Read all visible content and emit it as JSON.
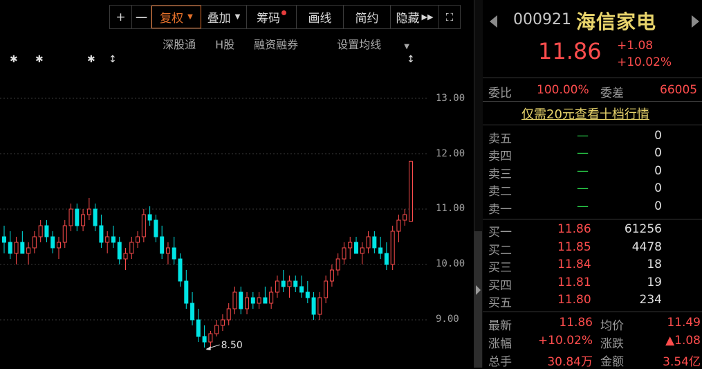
{
  "toolbar": {
    "plus": "+",
    "minus": "一",
    "fuquan": "复权",
    "diejia": "叠加",
    "chouma": "筹码",
    "huaxian": "画线",
    "jianyue": "简约",
    "yincang": "隐藏"
  },
  "subbar": {
    "sgt": "深股通",
    "hgu": "H股",
    "rzrq": "融资融券",
    "sheding": "设置均线"
  },
  "axis": {
    "ticks": [
      "13.00",
      "12.00",
      "11.00",
      "10.00",
      "9.00"
    ],
    "low_label": "8.50"
  },
  "stock": {
    "code": "000921",
    "name": "海信家电",
    "price": "11.86",
    "change": "+1.08",
    "change_pct": "+10.02%"
  },
  "weibi": {
    "label1": "委比",
    "value1": "100.00%",
    "label2": "委差",
    "value2": "66005"
  },
  "promo": "仅需20元查看十档行情",
  "asks": [
    {
      "label": "卖五",
      "price": "—",
      "vol": "0"
    },
    {
      "label": "卖四",
      "price": "—",
      "vol": "0"
    },
    {
      "label": "卖三",
      "price": "—",
      "vol": "0"
    },
    {
      "label": "卖二",
      "price": "—",
      "vol": "0"
    },
    {
      "label": "卖一",
      "price": "—",
      "vol": "0"
    }
  ],
  "bids": [
    {
      "label": "买一",
      "price": "11.86",
      "vol": "61256"
    },
    {
      "label": "买二",
      "price": "11.85",
      "vol": "4478"
    },
    {
      "label": "买三",
      "price": "11.84",
      "vol": "18"
    },
    {
      "label": "买四",
      "price": "11.81",
      "vol": "19"
    },
    {
      "label": "买五",
      "price": "11.80",
      "vol": "234"
    }
  ],
  "stats": [
    {
      "l1": "最新",
      "v1": "11.86",
      "l2": "均价",
      "v2": "11.49"
    },
    {
      "l1": "涨幅",
      "v1": "+10.02%",
      "l2": "涨跌",
      "v2": "▲1.08"
    },
    {
      "l1": "总手",
      "v1": "30.84万",
      "l2": "金额",
      "v2": "3.54亿"
    }
  ],
  "chart_data": {
    "type": "candlestick",
    "y_ticks": [
      13.0,
      12.0,
      11.0,
      10.0,
      9.0
    ],
    "ylim": [
      8.3,
      13.5
    ],
    "low_marker": 8.5,
    "candles": [
      [
        10.5,
        10.7,
        10.2,
        10.4
      ],
      [
        10.4,
        10.6,
        10.1,
        10.2
      ],
      [
        10.2,
        10.5,
        10.0,
        10.4
      ],
      [
        10.4,
        10.6,
        10.2,
        10.2
      ],
      [
        10.2,
        10.4,
        10.0,
        10.3
      ],
      [
        10.3,
        10.6,
        10.2,
        10.5
      ],
      [
        10.5,
        10.8,
        10.4,
        10.7
      ],
      [
        10.7,
        10.8,
        10.4,
        10.5
      ],
      [
        10.5,
        10.6,
        10.2,
        10.3
      ],
      [
        10.3,
        10.5,
        10.1,
        10.4
      ],
      [
        10.4,
        10.8,
        10.3,
        10.7
      ],
      [
        10.7,
        11.1,
        10.6,
        11.0
      ],
      [
        11.0,
        11.1,
        10.6,
        10.7
      ],
      [
        10.7,
        11.0,
        10.6,
        10.9
      ],
      [
        10.9,
        11.2,
        10.8,
        11.0
      ],
      [
        11.0,
        11.1,
        10.6,
        10.7
      ],
      [
        10.7,
        10.9,
        10.3,
        10.4
      ],
      [
        10.4,
        10.6,
        10.2,
        10.5
      ],
      [
        10.5,
        10.7,
        10.3,
        10.4
      ],
      [
        10.4,
        10.5,
        10.0,
        10.1
      ],
      [
        10.1,
        10.3,
        9.9,
        10.2
      ],
      [
        10.2,
        10.5,
        10.1,
        10.4
      ],
      [
        10.4,
        10.6,
        10.3,
        10.5
      ],
      [
        10.5,
        11.0,
        10.4,
        10.9
      ],
      [
        10.9,
        11.05,
        10.7,
        10.8
      ],
      [
        10.8,
        10.9,
        10.4,
        10.5
      ],
      [
        10.5,
        10.7,
        10.1,
        10.2
      ],
      [
        10.2,
        10.4,
        10.0,
        10.3
      ],
      [
        10.3,
        10.5,
        10.0,
        10.1
      ],
      [
        10.1,
        10.2,
        9.6,
        9.7
      ],
      [
        9.7,
        9.9,
        9.2,
        9.3
      ],
      [
        9.3,
        9.5,
        8.9,
        9.0
      ],
      [
        9.0,
        9.2,
        8.6,
        8.7
      ],
      [
        8.7,
        8.9,
        8.5,
        8.6
      ],
      [
        8.6,
        8.8,
        8.5,
        8.75
      ],
      [
        8.75,
        9.0,
        8.7,
        8.9
      ],
      [
        8.9,
        9.1,
        8.8,
        9.0
      ],
      [
        9.0,
        9.3,
        8.9,
        9.2
      ],
      [
        9.2,
        9.6,
        9.1,
        9.5
      ],
      [
        9.5,
        9.6,
        9.1,
        9.2
      ],
      [
        9.2,
        9.5,
        9.1,
        9.4
      ],
      [
        9.4,
        9.5,
        9.2,
        9.3
      ],
      [
        9.3,
        9.5,
        9.2,
        9.4
      ],
      [
        9.4,
        9.6,
        9.3,
        9.3
      ],
      [
        9.3,
        9.6,
        9.2,
        9.5
      ],
      [
        9.5,
        9.8,
        9.4,
        9.7
      ],
      [
        9.7,
        9.9,
        9.5,
        9.6
      ],
      [
        9.6,
        9.8,
        9.4,
        9.7
      ],
      [
        9.7,
        9.8,
        9.5,
        9.6
      ],
      [
        9.6,
        9.8,
        9.4,
        9.5
      ],
      [
        9.5,
        9.7,
        9.3,
        9.4
      ],
      [
        9.4,
        9.5,
        9.0,
        9.1
      ],
      [
        9.1,
        9.5,
        9.0,
        9.4
      ],
      [
        9.4,
        9.8,
        9.3,
        9.7
      ],
      [
        9.7,
        10.0,
        9.6,
        9.9
      ],
      [
        9.9,
        10.2,
        9.8,
        10.1
      ],
      [
        10.1,
        10.4,
        10.0,
        10.3
      ],
      [
        10.3,
        10.5,
        10.1,
        10.4
      ],
      [
        10.4,
        10.5,
        10.2,
        10.2
      ],
      [
        10.2,
        10.4,
        10.0,
        10.3
      ],
      [
        10.3,
        10.6,
        10.2,
        10.5
      ],
      [
        10.5,
        10.6,
        10.2,
        10.3
      ],
      [
        10.3,
        10.5,
        10.1,
        10.2
      ],
      [
        10.2,
        10.4,
        9.9,
        10.0
      ],
      [
        10.0,
        10.7,
        9.9,
        10.6
      ],
      [
        10.6,
        10.9,
        10.4,
        10.8
      ],
      [
        10.8,
        11.0,
        10.7,
        10.9
      ],
      [
        10.78,
        11.87,
        10.78,
        11.86
      ]
    ]
  }
}
